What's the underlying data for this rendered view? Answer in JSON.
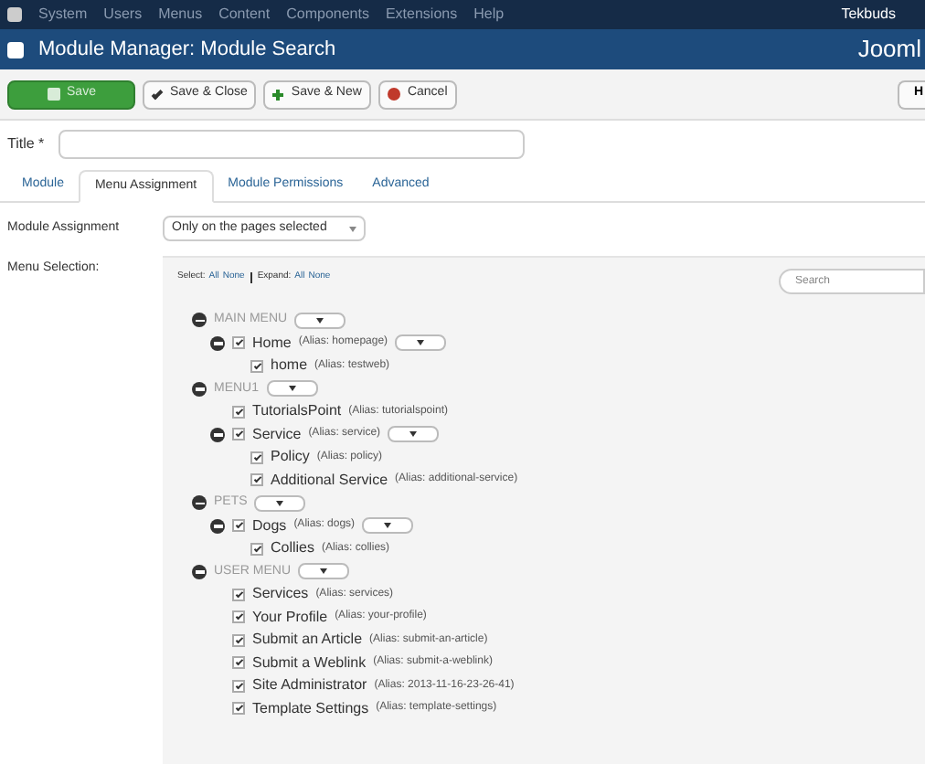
{
  "topbar": {
    "menu": [
      "System",
      "Users",
      "Menus",
      "Content",
      "Components",
      "Extensions",
      "Help"
    ],
    "user": "Tekbuds"
  },
  "header": {
    "title": "Module Manager: Module Search",
    "brand": "Jooml"
  },
  "toolbar": {
    "buttons": [
      {
        "label": "Save",
        "kind": "primary"
      },
      {
        "label": "Save & Close",
        "kind": "check"
      },
      {
        "label": "Save & New",
        "kind": "plus"
      },
      {
        "label": "Cancel",
        "kind": "cancel"
      }
    ],
    "help": "H"
  },
  "title_field": {
    "label": "Title *"
  },
  "tabs": [
    {
      "label": "Module",
      "selected": false
    },
    {
      "label": "Menu Assignment",
      "selected": true
    },
    {
      "label": "Module Permissions",
      "selected": false
    },
    {
      "label": "Advanced",
      "selected": false
    }
  ],
  "module_assignment": {
    "label": "Module Assignment",
    "value": "Only on the pages selected"
  },
  "menu_selection": {
    "label": "Menu Selection:",
    "select_label": "Select:",
    "select_links": [
      "All",
      "None"
    ],
    "expand_label": "Expand:",
    "expand_links": [
      "All",
      "None"
    ],
    "search_placeholder": "Search",
    "menus": [
      {
        "title": "MAIN MENU",
        "expanded": true,
        "items": [
          {
            "label": "Home",
            "alias": "(Alias: homepage)",
            "checked": true,
            "expanded": true,
            "children": [
              {
                "label": "home",
                "alias": "(Alias: testweb)",
                "checked": true
              }
            ]
          }
        ]
      },
      {
        "title": "MENU1",
        "expanded": true,
        "items": [
          {
            "label": "TutorialsPoint",
            "alias": "(Alias: tutorialspoint)",
            "checked": true
          },
          {
            "label": "Service",
            "alias": "(Alias: service)",
            "checked": true,
            "expanded": true,
            "children": [
              {
                "label": "Policy",
                "alias": "(Alias: policy)",
                "checked": true
              },
              {
                "label": "Additional Service",
                "alias": "(Alias: additional-service)",
                "checked": true
              }
            ]
          }
        ]
      },
      {
        "title": "PETS",
        "expanded": true,
        "items": [
          {
            "label": "Dogs",
            "alias": "(Alias: dogs)",
            "checked": true,
            "expanded": true,
            "children": [
              {
                "label": "Collies",
                "alias": "(Alias: collies)",
                "checked": true
              }
            ]
          }
        ]
      },
      {
        "title": "USER MENU",
        "expanded": true,
        "items": [
          {
            "label": "Services",
            "alias": "(Alias: services)",
            "checked": true
          },
          {
            "label": "Your Profile",
            "alias": "(Alias: your-profile)",
            "checked": true
          },
          {
            "label": "Submit an Article",
            "alias": "(Alias: submit-an-article)",
            "checked": true
          },
          {
            "label": "Submit a Weblink",
            "alias": "(Alias: submit-a-weblink)",
            "checked": true
          },
          {
            "label": "Site Administrator",
            "alias": "(Alias: 2013-11-16-23-26-41)",
            "checked": true
          },
          {
            "label": "Template Settings",
            "alias": "(Alias: template-settings)",
            "checked": true
          }
        ]
      }
    ]
  }
}
